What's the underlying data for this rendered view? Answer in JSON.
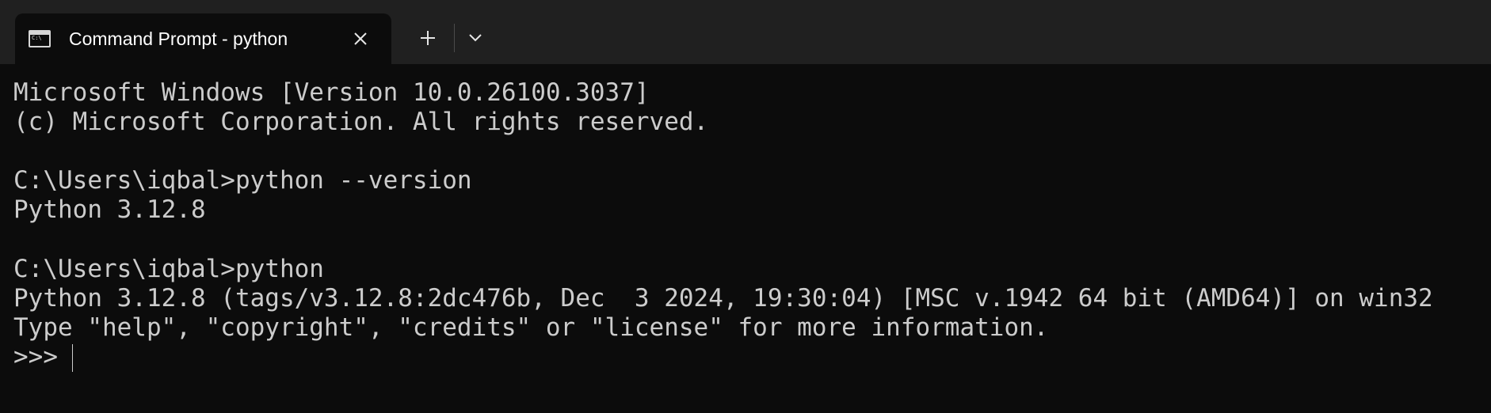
{
  "window": {
    "tab_title": "Command Prompt - python",
    "tab_icon": "console-icon"
  },
  "titlebar": {
    "close_icon": "close-icon",
    "new_tab_icon": "plus-icon",
    "dropdown_icon": "chevron-down-icon"
  },
  "terminal": {
    "lines": [
      "Microsoft Windows [Version 10.0.26100.3037]",
      "(c) Microsoft Corporation. All rights reserved.",
      "",
      "C:\\Users\\iqbal>python --version",
      "Python 3.12.8",
      "",
      "C:\\Users\\iqbal>python",
      "Python 3.12.8 (tags/v3.12.8:2dc476b, Dec  3 2024, 19:30:04) [MSC v.1942 64 bit (AMD64)] on win32",
      "Type \"help\", \"copyright\", \"credits\" or \"license\" for more information.",
      ">>> "
    ]
  },
  "colors": {
    "background": "#0c0c0c",
    "titlebar": "#202020",
    "text": "#cccccc"
  }
}
